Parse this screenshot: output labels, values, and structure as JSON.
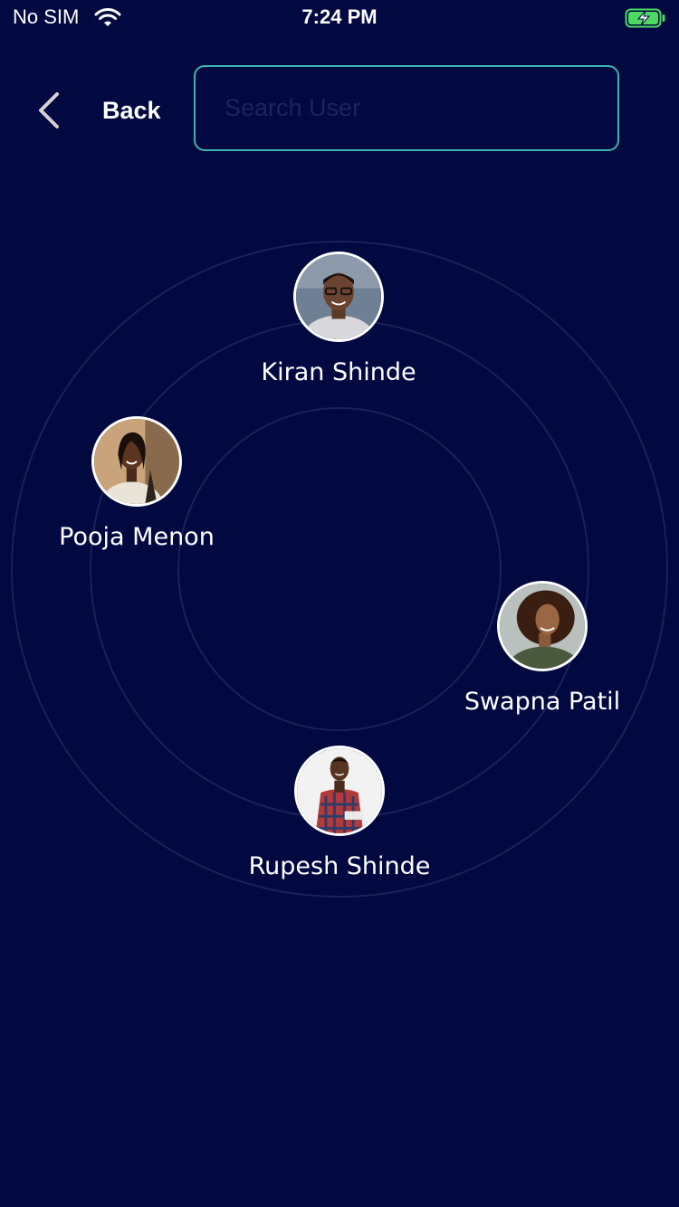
{
  "status_bar": {
    "carrier": "No SIM",
    "time": "7:24 PM",
    "wifi_icon": "wifi-icon",
    "battery_icon": "battery-charging-icon",
    "battery_color": "#4cd964"
  },
  "header": {
    "back_label": "Back",
    "back_icon": "chevron-left-icon",
    "search": {
      "placeholder": "Search User",
      "value": ""
    }
  },
  "colors": {
    "background": "#020840",
    "accent": "#3fb3ad",
    "ring": "#1a2158"
  },
  "users": [
    {
      "name": "Kiran Shinde"
    },
    {
      "name": "Pooja Menon"
    },
    {
      "name": "Swapna Patil"
    },
    {
      "name": "Rupesh Shinde"
    }
  ]
}
